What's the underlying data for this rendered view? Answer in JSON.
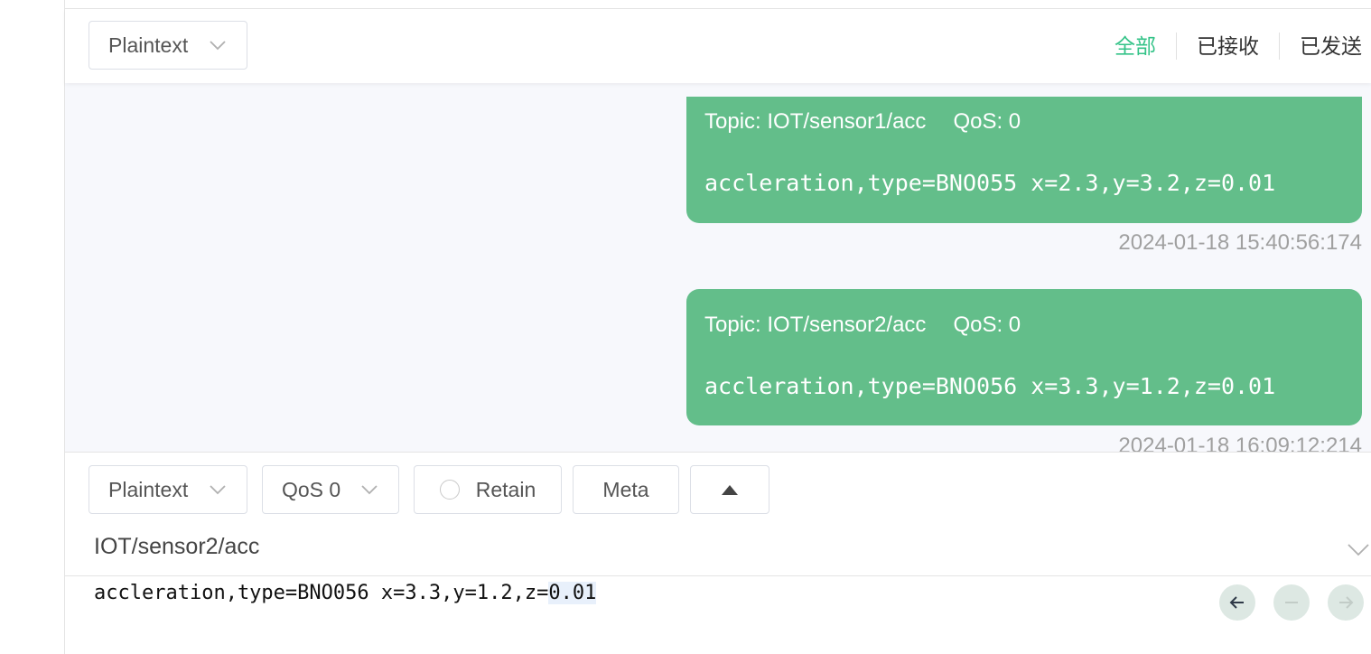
{
  "header": {
    "format_select": "Plaintext",
    "tabs": [
      {
        "label": "全部",
        "active": true
      },
      {
        "label": "已接收",
        "active": false
      },
      {
        "label": "已发送",
        "active": false
      }
    ]
  },
  "messages": [
    {
      "topic": "Topic: IOT/sensor1/acc",
      "qos": "QoS: 0",
      "payload": "accleration,type=BNO055 x=2.3,y=3.2,z=0.01",
      "time": "2024-01-18 15:40:56:174"
    },
    {
      "topic": "Topic: IOT/sensor2/acc",
      "qos": "QoS: 0",
      "payload": "accleration,type=BNO056 x=3.3,y=1.2,z=0.01",
      "time": "2024-01-18 16:09:12:214"
    }
  ],
  "composer": {
    "format_select": "Plaintext",
    "qos_select": "QoS 0",
    "retain_label": "Retain",
    "meta_label": "Meta",
    "topic": "IOT/sensor2/acc",
    "payload_main": "accleration,type=BNO056 x=3.3,y=1.2,z=",
    "payload_selected": "0.01"
  },
  "colors": {
    "accent": "#34c388",
    "bubble": "#63be8a",
    "message_bg": "#f7f8fc"
  },
  "icons": {
    "select_chevron": "chevron-down-icon",
    "up": "caret-up-icon",
    "prev": "arrow-left-icon",
    "current": "minus-icon",
    "next": "arrow-right-icon"
  }
}
